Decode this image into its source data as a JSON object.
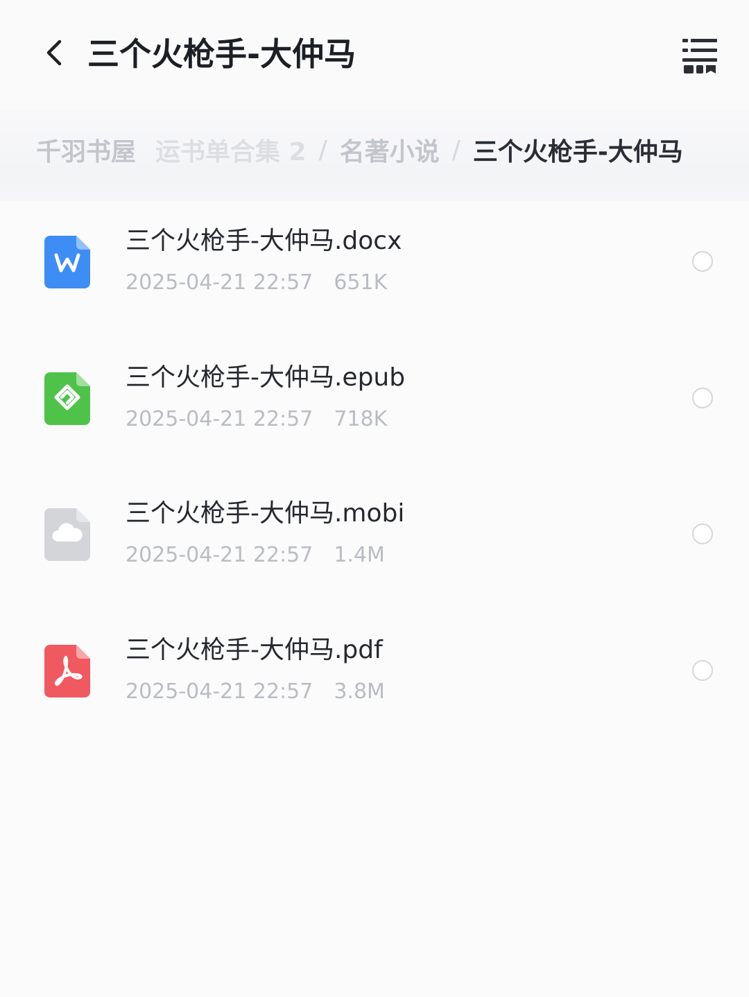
{
  "header": {
    "title": "三个火枪手-大仲马"
  },
  "breadcrumb": {
    "items": [
      "千羽书屋",
      "运书单合集 2",
      "名著小说",
      "三个火枪手-大仲马"
    ],
    "separator": "/"
  },
  "files": [
    {
      "name": "三个火枪手-大仲马.docx",
      "date": "2025-04-21 22:57",
      "size": "651K",
      "icon": "word-document-icon",
      "color": "#3d8df5"
    },
    {
      "name": "三个火枪手-大仲马.epub",
      "date": "2025-04-21 22:57",
      "size": "718K",
      "icon": "epub-document-icon",
      "color": "#4fc24a"
    },
    {
      "name": "三个火枪手-大仲马.mobi",
      "date": "2025-04-21 22:57",
      "size": "1.4M",
      "icon": "mobi-cloud-document-icon",
      "color": "#d3d5d9"
    },
    {
      "name": "三个火枪手-大仲马.pdf",
      "date": "2025-04-21 22:57",
      "size": "3.8M",
      "icon": "pdf-document-icon",
      "color": "#f0595f"
    }
  ]
}
